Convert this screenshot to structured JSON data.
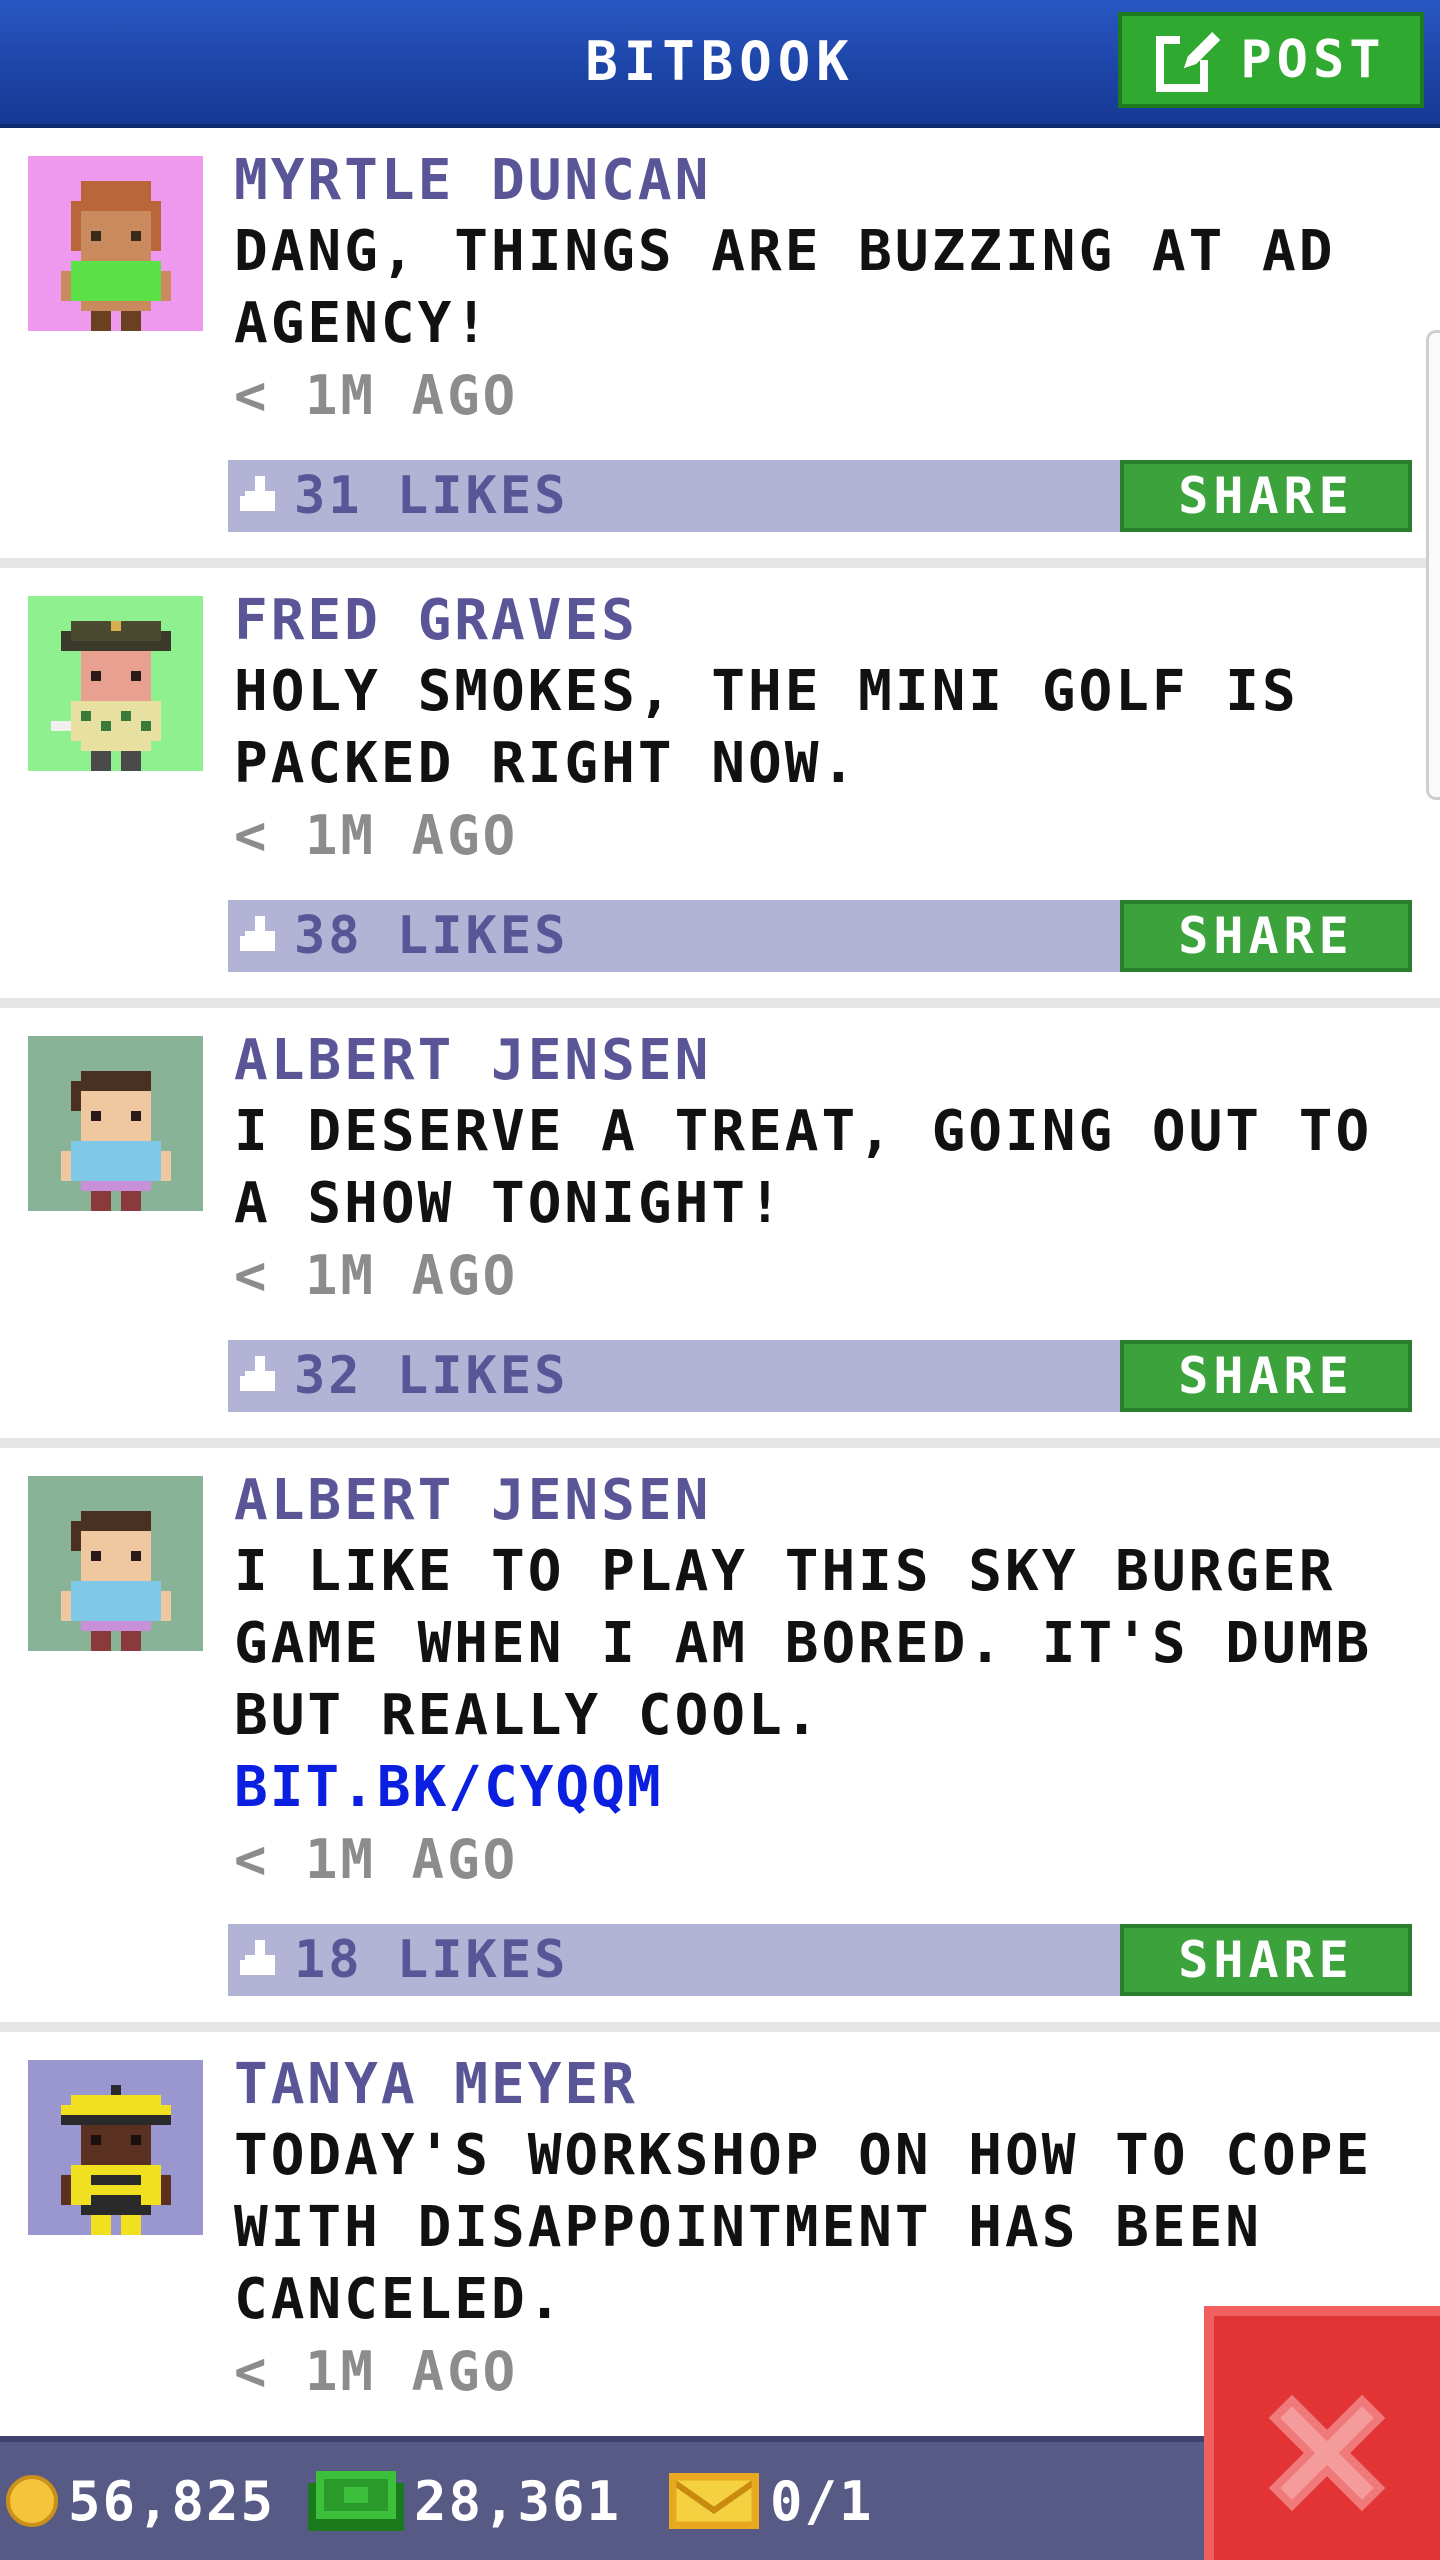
{
  "header": {
    "title": "BITBOOK",
    "post_label": "POST"
  },
  "posts": [
    {
      "name": "MYRTLE DUNCAN",
      "text": "DANG, THINGS ARE BUZZING AT AD AGENCY!",
      "link": "",
      "time": "< 1M AGO",
      "likes": "31 LIKES",
      "share": "SHARE",
      "avatar_bg": "#ee99ee",
      "avatar": "woman-green-shirt"
    },
    {
      "name": "FRED GRAVES",
      "text": "HOLY SMOKES, THE MINI GOLF IS PACKED RIGHT NOW.",
      "link": "",
      "time": "< 1M AGO",
      "likes": "38 LIKES",
      "share": "SHARE",
      "avatar_bg": "#8ff08f",
      "avatar": "golfer"
    },
    {
      "name": "ALBERT JENSEN",
      "text": "I DESERVE A TREAT, GOING OUT TO A SHOW TONIGHT!",
      "link": "",
      "time": "< 1M AGO",
      "likes": "32 LIKES",
      "share": "SHARE",
      "avatar_bg": "#88b396",
      "avatar": "man-blue-shirt"
    },
    {
      "name": "ALBERT JENSEN",
      "text": "I LIKE TO PLAY THIS SKY BURGER GAME WHEN I AM BORED. IT'S DUMB BUT REALLY COOL.",
      "link": "BIT.BK/CYQQM",
      "time": "< 1M AGO",
      "likes": "18 LIKES",
      "share": "SHARE",
      "avatar_bg": "#88b396",
      "avatar": "man-blue-shirt"
    },
    {
      "name": "TANYA MEYER",
      "text": "TODAY'S WORKSHOP ON HOW TO COPE WITH DISAPPOINTMENT HAS BEEN CANCELED.",
      "link": "",
      "time": "< 1M AGO",
      "likes": "",
      "share": "",
      "avatar_bg": "#9a96d0",
      "avatar": "yellow-uniform"
    }
  ],
  "status": {
    "coins": "56,825",
    "bux": "28,361",
    "tickets": "0/1"
  },
  "colors": {
    "header": "#1d45a8",
    "post_button": "#2fa92f",
    "likes_bar": "#b3b3d6",
    "share_button": "#3ca33c",
    "name": "#5a5596",
    "link": "#0a1fe0",
    "bottom_bar": "#585a86",
    "close": "#e23434"
  }
}
